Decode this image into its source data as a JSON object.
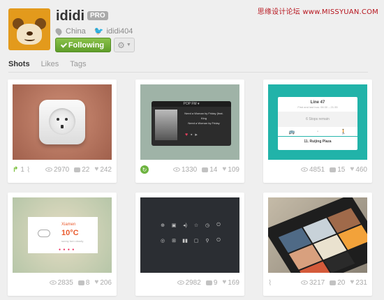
{
  "watermark": "思缘设计论坛 www.MISSYUAN.COM",
  "profile": {
    "username": "ididi",
    "badge": "PRO",
    "location": "China",
    "twitter": "ididi404",
    "follow_label": "Following"
  },
  "tabs": [
    {
      "label": "Shots",
      "active": true
    },
    {
      "label": "Likes",
      "active": false
    },
    {
      "label": "Tags",
      "active": false
    }
  ],
  "player": {
    "station": "POP FM ▾",
    "track": "Need a Woman by Friday (feat.",
    "artist": "King",
    "next": "Need a Woman by Friday"
  },
  "transit": {
    "line": "Line 47",
    "sub": "First and last bus: 06:30 – 21:35",
    "remain": "6 Stops remain",
    "stop": "11. Ruijing Plaza"
  },
  "weather": {
    "city": "Xiamen",
    "temp": "10°C",
    "desc": "sunny turn cloudy"
  },
  "shots": [
    {
      "rebounds": "1",
      "views": "2970",
      "comments": "22",
      "likes": "242"
    },
    {
      "views": "1330",
      "comments": "14",
      "likes": "109"
    },
    {
      "views": "4851",
      "comments": "15",
      "likes": "460"
    },
    {
      "views": "2835",
      "comments": "8",
      "likes": "206"
    },
    {
      "views": "2982",
      "comments": "9",
      "likes": "169"
    },
    {
      "views": "3217",
      "comments": "20",
      "likes": "231"
    }
  ],
  "colors": {
    "follow": "#6aae34",
    "teal": "#21b3a9",
    "accent_orange": "#ea5b2e"
  }
}
